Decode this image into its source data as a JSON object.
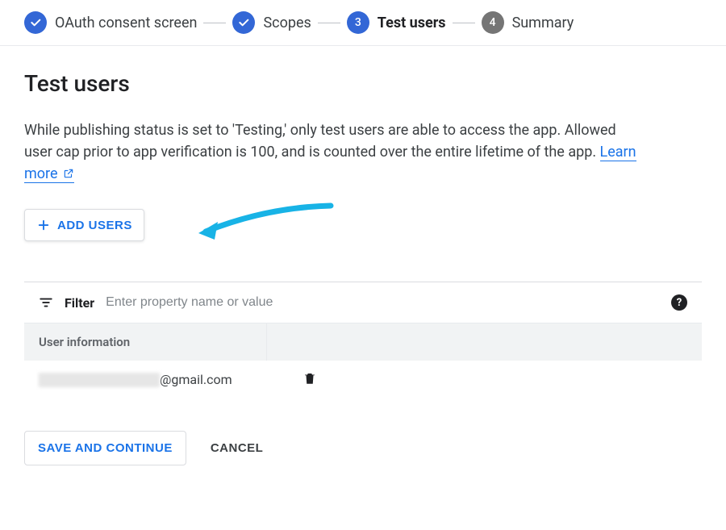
{
  "stepper": {
    "steps": [
      {
        "label": "OAuth consent screen",
        "state": "done"
      },
      {
        "label": "Scopes",
        "state": "done"
      },
      {
        "label": "Test users",
        "state": "current",
        "number": "3"
      },
      {
        "label": "Summary",
        "state": "upcoming",
        "number": "4"
      }
    ]
  },
  "page": {
    "title": "Test users",
    "description_prefix": "While publishing status is set to 'Testing,' only test users are able to access the app. Allowed user cap prior to app verification is 100, and is counted over the entire lifetime of the app. ",
    "learn_more": "Learn more"
  },
  "buttons": {
    "add_users": "ADD USERS",
    "save": "SAVE AND CONTINUE",
    "cancel": "CANCEL"
  },
  "filter": {
    "label": "Filter",
    "placeholder": "Enter property name or value"
  },
  "table": {
    "header": "User information",
    "rows": [
      {
        "email_visible_suffix": "@gmail.com"
      }
    ]
  },
  "help_tooltip": "?"
}
